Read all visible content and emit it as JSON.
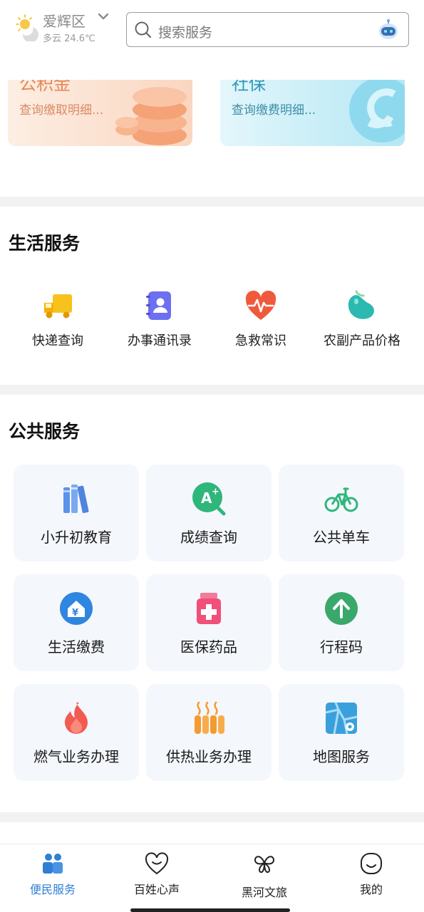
{
  "header": {
    "location": "爱辉区",
    "weather": "多云 24.6℃",
    "search_placeholder": "搜索服务",
    "icons": {
      "weather": "partly-cloudy-icon",
      "chevron": "chevron-down-icon",
      "search": "search-icon",
      "assistant": "robot-assistant-icon"
    }
  },
  "cards": [
    {
      "title": "公积金",
      "subtitle": "查询缴取明细...",
      "color": "#e88552"
    },
    {
      "title": "社保",
      "subtitle": "查询缴费明细...",
      "color": "#2f9ab8"
    }
  ],
  "life_services": {
    "title": "生活服务",
    "items": [
      {
        "label": "快递查询",
        "icon": "delivery-truck-icon",
        "color": "#f5b800"
      },
      {
        "label": "办事通讯录",
        "icon": "contact-book-icon",
        "color": "#6c6ff0"
      },
      {
        "label": "急救常识",
        "icon": "heart-pulse-icon",
        "color": "#ef5a3c"
      },
      {
        "label": "农副产品价格",
        "icon": "bean-produce-icon",
        "color": "#2bb9b0"
      }
    ]
  },
  "public_services": {
    "title": "公共服务",
    "items": [
      {
        "label": "小升初教育",
        "icon": "books-icon",
        "color": "#4f8de8"
      },
      {
        "label": "成绩查询",
        "icon": "grade-search-icon",
        "color": "#2fb67a"
      },
      {
        "label": "公共单车",
        "icon": "bicycle-icon",
        "color": "#2fb67a"
      },
      {
        "label": "生活缴费",
        "icon": "payment-home-icon",
        "color": "#2f86e0"
      },
      {
        "label": "医保药品",
        "icon": "medicine-bottle-icon",
        "color": "#f0507a"
      },
      {
        "label": "行程码",
        "icon": "arrow-up-circle-icon",
        "color": "#3aa86b"
      },
      {
        "label": "燃气业务办理",
        "icon": "flame-icon",
        "color": "#f25a52"
      },
      {
        "label": "供热业务办理",
        "icon": "radiator-icon",
        "color": "#f59a2e"
      },
      {
        "label": "地图服务",
        "icon": "map-icon",
        "color": "#3aa0dd"
      }
    ]
  },
  "tabbar": {
    "active_color": "#2f7fd6",
    "items": [
      {
        "label": "便民服务",
        "icon": "people-icon",
        "active": true
      },
      {
        "label": "百姓心声",
        "icon": "heart-chat-icon",
        "active": false
      },
      {
        "label": "黑河文旅",
        "icon": "butterfly-icon",
        "active": false
      },
      {
        "label": "我的",
        "icon": "smile-face-icon",
        "active": false
      }
    ]
  }
}
